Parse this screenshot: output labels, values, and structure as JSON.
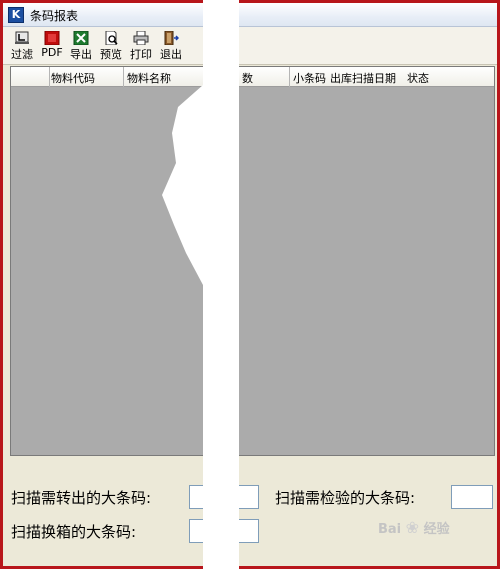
{
  "window": {
    "title": "条码报表",
    "icon_letter": "K"
  },
  "toolbar": {
    "buttons": [
      {
        "label": "过滤",
        "icon": "filter-icon"
      },
      {
        "label": "PDF",
        "icon": "pdf-icon"
      },
      {
        "label": "导出",
        "icon": "excel-export-icon"
      },
      {
        "label": "预览",
        "icon": "print-preview-icon"
      },
      {
        "label": "打印",
        "icon": "printer-icon"
      },
      {
        "label": "退出",
        "icon": "exit-icon"
      }
    ]
  },
  "grid": {
    "columns": [
      "物料代码",
      "物料名称",
      "数",
      "小条码",
      "出库扫描日期",
      "状态"
    ]
  },
  "scan": {
    "transfer_out_label": "扫描需转出的大条码:",
    "inspect_label": "扫描需检验的大条码:",
    "rebox_label": "扫描换箱的大条码:"
  },
  "watermark": {
    "text": "Bai",
    "text2": "经验"
  },
  "colors": {
    "frame_border": "#b8161b",
    "grid_bg": "#ababab",
    "window_bg": "#ece9d8"
  }
}
